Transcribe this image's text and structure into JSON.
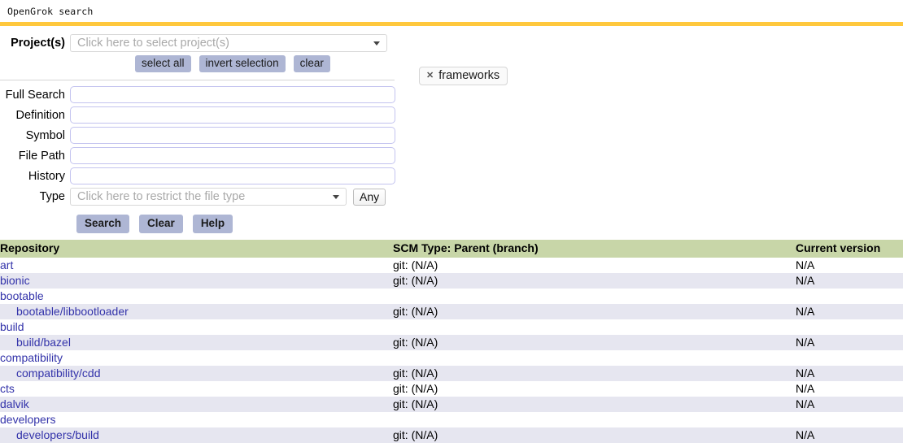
{
  "window": {
    "title": "OpenGrok search",
    "accent_color": "#ffc83d"
  },
  "form": {
    "projects": {
      "label": "Project(s)",
      "placeholder": "Click here to select project(s)",
      "value": "",
      "buttons": {
        "select_all": "select all",
        "invert_selection": "invert selection",
        "clear": "clear"
      },
      "selected_chips": [
        {
          "label": "frameworks",
          "remove_icon": "close-icon"
        }
      ]
    },
    "fields": [
      {
        "name": "full-search",
        "label": "Full Search",
        "value": "",
        "placeholder": ""
      },
      {
        "name": "definition",
        "label": "Definition",
        "value": "",
        "placeholder": ""
      },
      {
        "name": "symbol",
        "label": "Symbol",
        "value": "",
        "placeholder": ""
      },
      {
        "name": "file-path",
        "label": "File Path",
        "value": "",
        "placeholder": ""
      },
      {
        "name": "history",
        "label": "History",
        "value": "",
        "placeholder": ""
      }
    ],
    "type": {
      "label": "Type",
      "placeholder": "Click here to restrict the file type",
      "any_button": "Any"
    },
    "actions": {
      "search": "Search",
      "clear": "Clear",
      "help": "Help"
    }
  },
  "table": {
    "headers": [
      "Repository",
      "SCM Type: Parent (branch)",
      "Current version"
    ],
    "rows": [
      {
        "repo": "art",
        "indent": false,
        "scm": "git: (N/A)",
        "version": "N/A"
      },
      {
        "repo": "bionic",
        "indent": false,
        "scm": "git: (N/A)",
        "version": "N/A"
      },
      {
        "repo": "bootable",
        "indent": false,
        "scm": "",
        "version": ""
      },
      {
        "repo": "bootable/libbootloader",
        "indent": true,
        "scm": "git: (N/A)",
        "version": "N/A"
      },
      {
        "repo": "build",
        "indent": false,
        "scm": "",
        "version": ""
      },
      {
        "repo": "build/bazel",
        "indent": true,
        "scm": "git: (N/A)",
        "version": "N/A"
      },
      {
        "repo": "compatibility",
        "indent": false,
        "scm": "",
        "version": ""
      },
      {
        "repo": "compatibility/cdd",
        "indent": true,
        "scm": "git: (N/A)",
        "version": "N/A"
      },
      {
        "repo": "cts",
        "indent": false,
        "scm": "git: (N/A)",
        "version": "N/A"
      },
      {
        "repo": "dalvik",
        "indent": false,
        "scm": "git: (N/A)",
        "version": "N/A"
      },
      {
        "repo": "developers",
        "indent": false,
        "scm": "",
        "version": ""
      },
      {
        "repo": "developers/build",
        "indent": true,
        "scm": "git: (N/A)",
        "version": "N/A"
      }
    ]
  }
}
